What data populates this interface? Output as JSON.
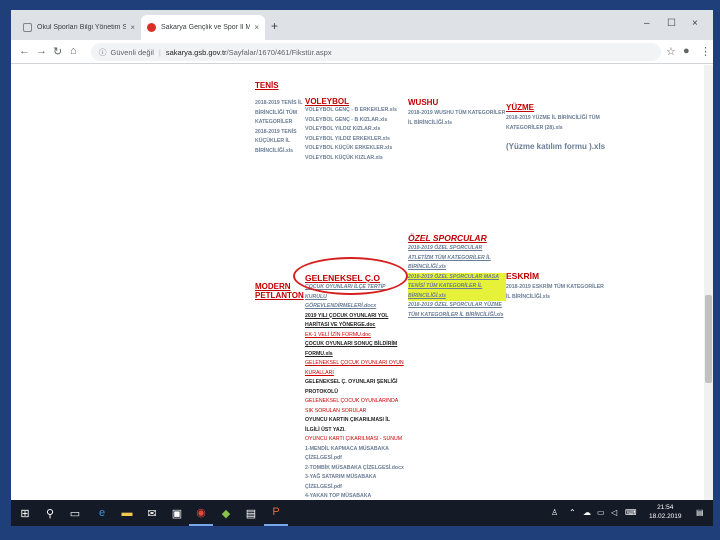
{
  "browser": {
    "tabs": [
      {
        "title": "Okul Sporları Bilgi Yönetim Siste",
        "close": "×"
      },
      {
        "title": "Sakarya Gençlik ve Spor İl Müdü",
        "close": "×"
      }
    ],
    "new_tab": "+",
    "window_controls": [
      "–",
      "☐",
      "×"
    ],
    "security": "Güvenli değil",
    "url_host": "sakarya.gsb.gov.tr",
    "url_path": "/Sayfalar/1670/461/Fikstür.aspx"
  },
  "page": {
    "tenis": {
      "heading": "TENİS",
      "links": [
        "2018-2019 TENİS İL BİRİNCİLİĞİ TÜM KATEGORİLER",
        "2018-2019 TENİS KÜÇÜKLER İL BİRİNCİLİĞİ.xls"
      ]
    },
    "voleybol": {
      "heading": "VOLEYBOL",
      "links": [
        "VOLEYBOL GENÇ - B ERKEKLER.xls",
        "VOLEYBOL GENÇ - B KIZLAR.xls",
        "VOLEYBOL YILDIZ KIZLAR.xls",
        "VOLEYBOL YILDIZ ERKEKLER.xls",
        "VOLEYBOL KÜÇÜK ERKEKLER.xls",
        "VOLEYBOL KÜÇÜK KIZLAR.xls"
      ]
    },
    "wushu": {
      "heading": "WUSHU",
      "links": [
        "2018-2019 WUSHU TÜM KATEGORİLER İL BİRİNCİLİĞİ.xls"
      ]
    },
    "yuzme": {
      "heading": "YÜZME",
      "links": [
        "2018-2019 YÜZME İL BİRİNCİLİĞİ TÜM KATEGORİLER (28).xls"
      ],
      "form": "(Yüzme katılım formu ).xls"
    },
    "modern": {
      "heading": "MODERN PETLANTON"
    },
    "geleneksel": {
      "heading": "GELENEKSEL Ç.O",
      "links": [
        "ÇOCUK OYUNLARI İLÇE TERTİP KURULU",
        "GÖREVLENDİRMELERİ.docx",
        "2019 YILI ÇOCUK OYUNLARI YOL HARİTASI VE YÖNERGE.doc",
        "EK-1 VELİ İZİN FORMU.doc",
        "ÇOCUK OYUNLARI SONUÇ BİLDİRİM FORMU.xls",
        "GELENEKSEL ÇOCUK OYUNLARI OYUN KURALLARI",
        "GELENEKSEL Ç. OYUNLARI ŞENLİĞİ PROTOKOLÜ",
        "GELENEKSEL ÇOCUK OYUNLARINDA SIK SORULAN SORULAR",
        "OYUNCU KARTIN ÇIKARILMASI İL İLGİLİ ÜST YAZI.",
        "OYUNCU KARTI ÇIKARILMASI - SUNUM",
        "1-MENDİL KAPMACA MÜSABAKA ÇİZELGESİ.pdf",
        "2-TOMBİK MÜSABAKA ÇİZELGESİ.docx",
        "3-YAĞ SATARIM MÜSABAKA ÇİZELGESİ.pdf",
        "4-YAKAN TOP MÜSABAKA ÇİZELGESİ.pdf"
      ]
    },
    "ozel": {
      "heading": "ÖZEL SPORCULAR",
      "links": [
        "2018-2019 ÖZEL SPORCULAR ATLETİZM TÜM KATEGORİLER İL BİRİNCİLİĞİ.xls",
        "2018-2019 ÖZEL SPORCULAR MASA TENİSİ TÜM KATEGORİLER İL BİRİNCİLİĞİ.xls",
        "2018-2019 ÖZEL SPORCULAR YÜZME TÜM KATEGORİLER İL BİRİNCİLİĞİ.xls"
      ]
    },
    "eskrim": {
      "heading": "ESKRİM",
      "links": [
        "2018-2019 ESKRİM TÜM KATEGORİLER İL BİRİNCİLİĞİ.xls"
      ]
    }
  },
  "taskbar": {
    "time": "21:54",
    "date": "18.02.2019"
  },
  "colors": {
    "heading": "#c00000",
    "link": "#6a7d96",
    "highlight": "#e6f23a",
    "annotation": "#d62020",
    "desktop": "#1f3f7a"
  }
}
